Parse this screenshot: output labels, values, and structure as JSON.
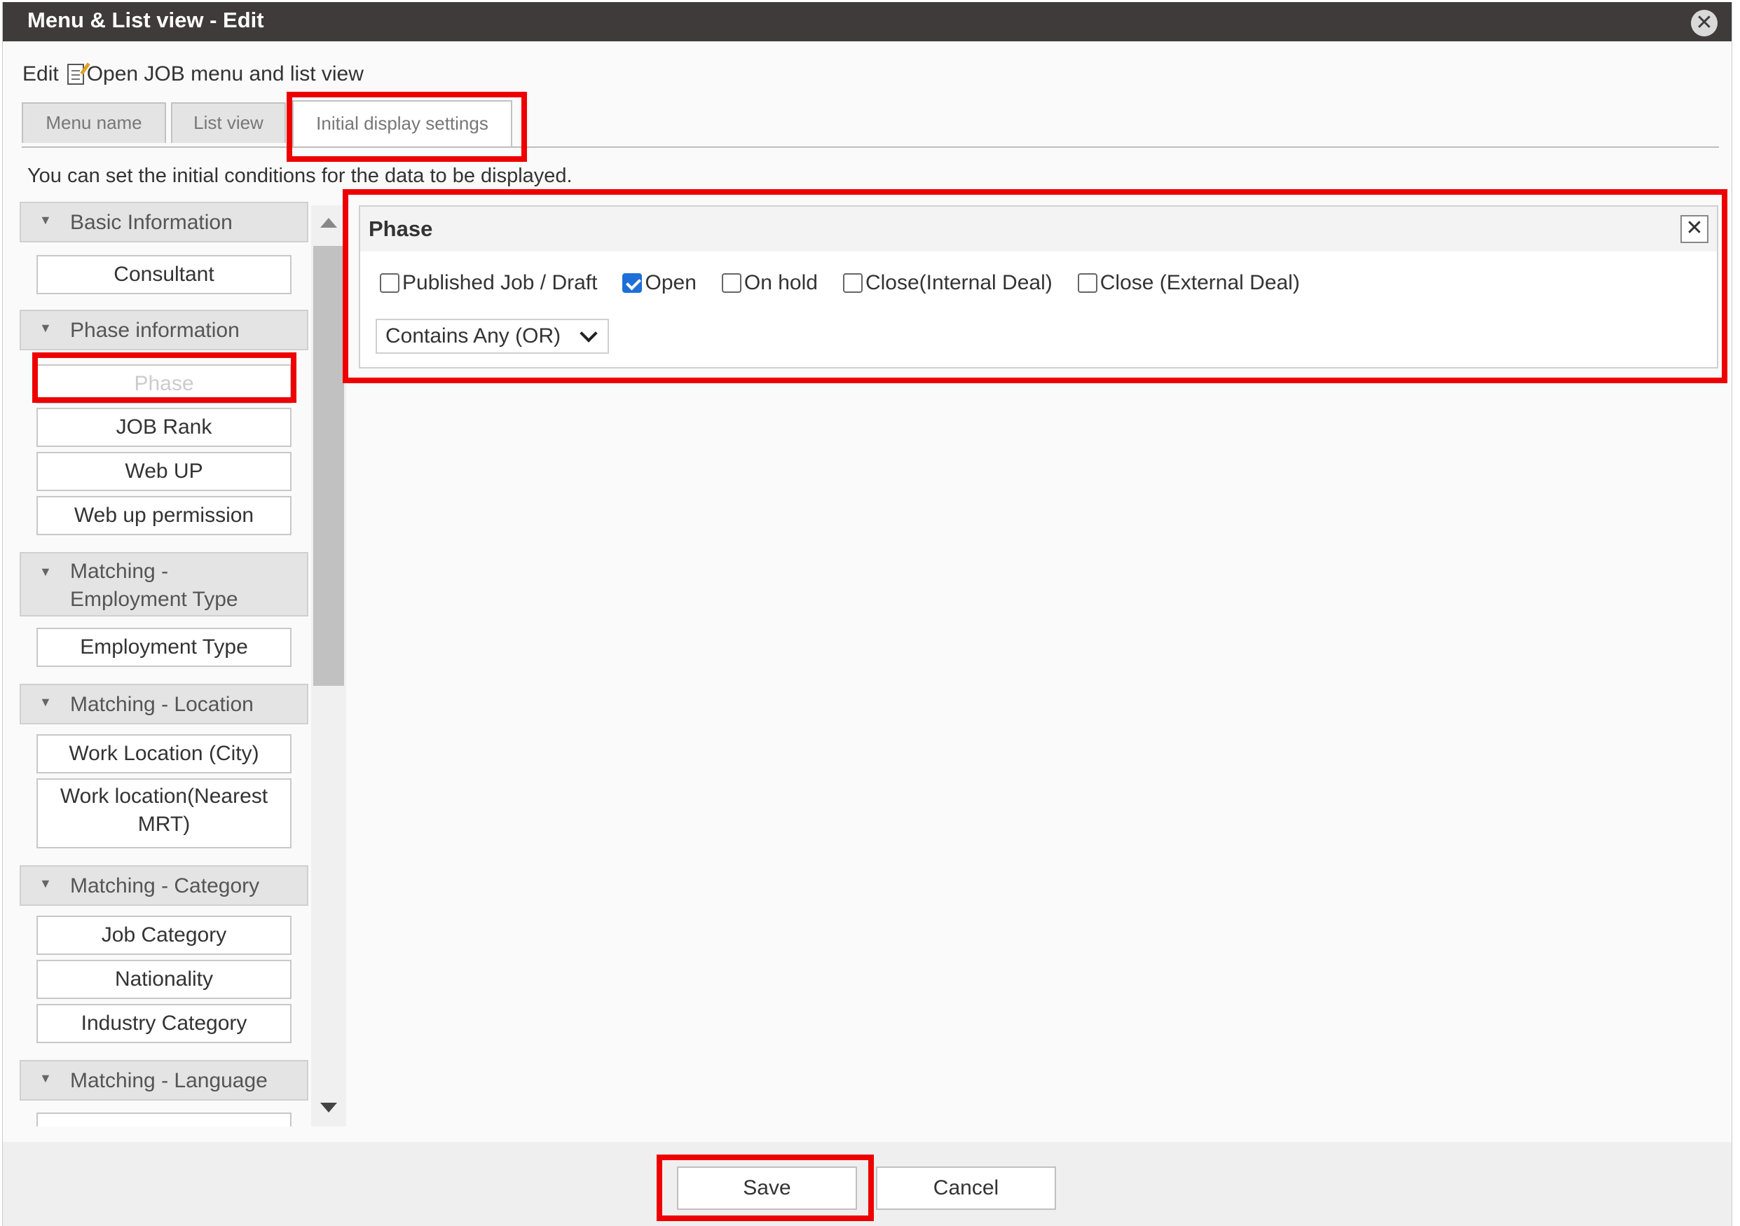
{
  "window": {
    "title": "Menu & List view - Edit",
    "close_symbol": "✕"
  },
  "edit_line": {
    "prefix": "Edit",
    "icon": "edit-document-icon",
    "label": "Open JOB menu and list view"
  },
  "tabs": [
    {
      "label": "Menu name"
    },
    {
      "label": "List view"
    },
    {
      "label": "Initial display settings",
      "active": true
    }
  ],
  "hint": "You can set the initial conditions for the data to be displayed.",
  "groups": [
    {
      "label": "Basic Information",
      "items": [
        "Consultant"
      ]
    },
    {
      "label": "Phase information",
      "items": [
        "Phase",
        "JOB Rank",
        "Web UP",
        "Web up permission"
      ]
    },
    {
      "label_line1": "Matching -",
      "label_line2": "Employment Type",
      "items": [
        "Employment Type"
      ]
    },
    {
      "label": "Matching - Location",
      "items": [
        "Work Location (City)"
      ],
      "item_two_line": [
        "Work location(Nearest",
        "MRT)"
      ]
    },
    {
      "label": "Matching - Category",
      "items": [
        "Job Category",
        "Nationality",
        "Industry Category"
      ]
    },
    {
      "label": "Matching - Language",
      "items": []
    }
  ],
  "panel": {
    "title": "Phase",
    "close_symbol": "✕",
    "options": [
      {
        "label": "Published Job / Draft",
        "checked": false
      },
      {
        "label": "Open",
        "checked": true
      },
      {
        "label": "On hold",
        "checked": false
      },
      {
        "label": "Close(Internal Deal)",
        "checked": false
      },
      {
        "label": "Close (External Deal)",
        "checked": false
      }
    ],
    "match_mode": "Contains Any (OR)"
  },
  "footer": {
    "save_label": "Save",
    "cancel_label": "Cancel"
  },
  "colors": {
    "title_bar": "#3f3b3b",
    "highlight": "#ee0000",
    "checkbox_checked": "#1e6fd9"
  }
}
